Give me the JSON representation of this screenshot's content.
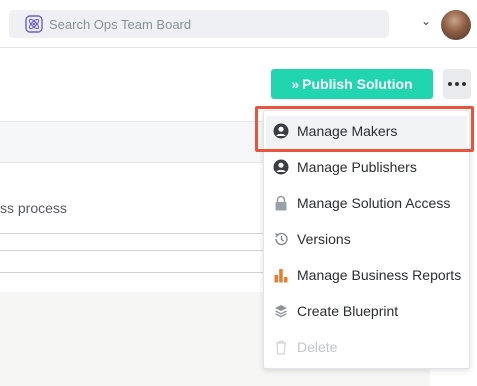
{
  "search": {
    "placeholder": "Search Ops Team Board",
    "icon": "atom-icon",
    "icon_color": "#6c5ce7"
  },
  "header": {
    "caret": "⌄"
  },
  "toolbar": {
    "publish_label": "Publish Solution",
    "publish_color": "#20d5b0"
  },
  "background": {
    "text": "ss process"
  },
  "menu": {
    "highlight_color": "#e8543d",
    "items": [
      {
        "label": "Manage Makers",
        "icon": "user-circle-icon",
        "disabled": false
      },
      {
        "label": "Manage Publishers",
        "icon": "user-circle-icon",
        "disabled": false
      },
      {
        "label": "Manage Solution Access",
        "icon": "lock-icon",
        "disabled": false
      },
      {
        "label": "Versions",
        "icon": "history-icon",
        "disabled": false
      },
      {
        "label": "Manage Business Reports",
        "icon": "bar-chart-icon",
        "disabled": false
      },
      {
        "label": "Create Blueprint",
        "icon": "layers-icon",
        "disabled": false
      },
      {
        "label": "Delete",
        "icon": "trash-icon",
        "disabled": true
      }
    ]
  }
}
